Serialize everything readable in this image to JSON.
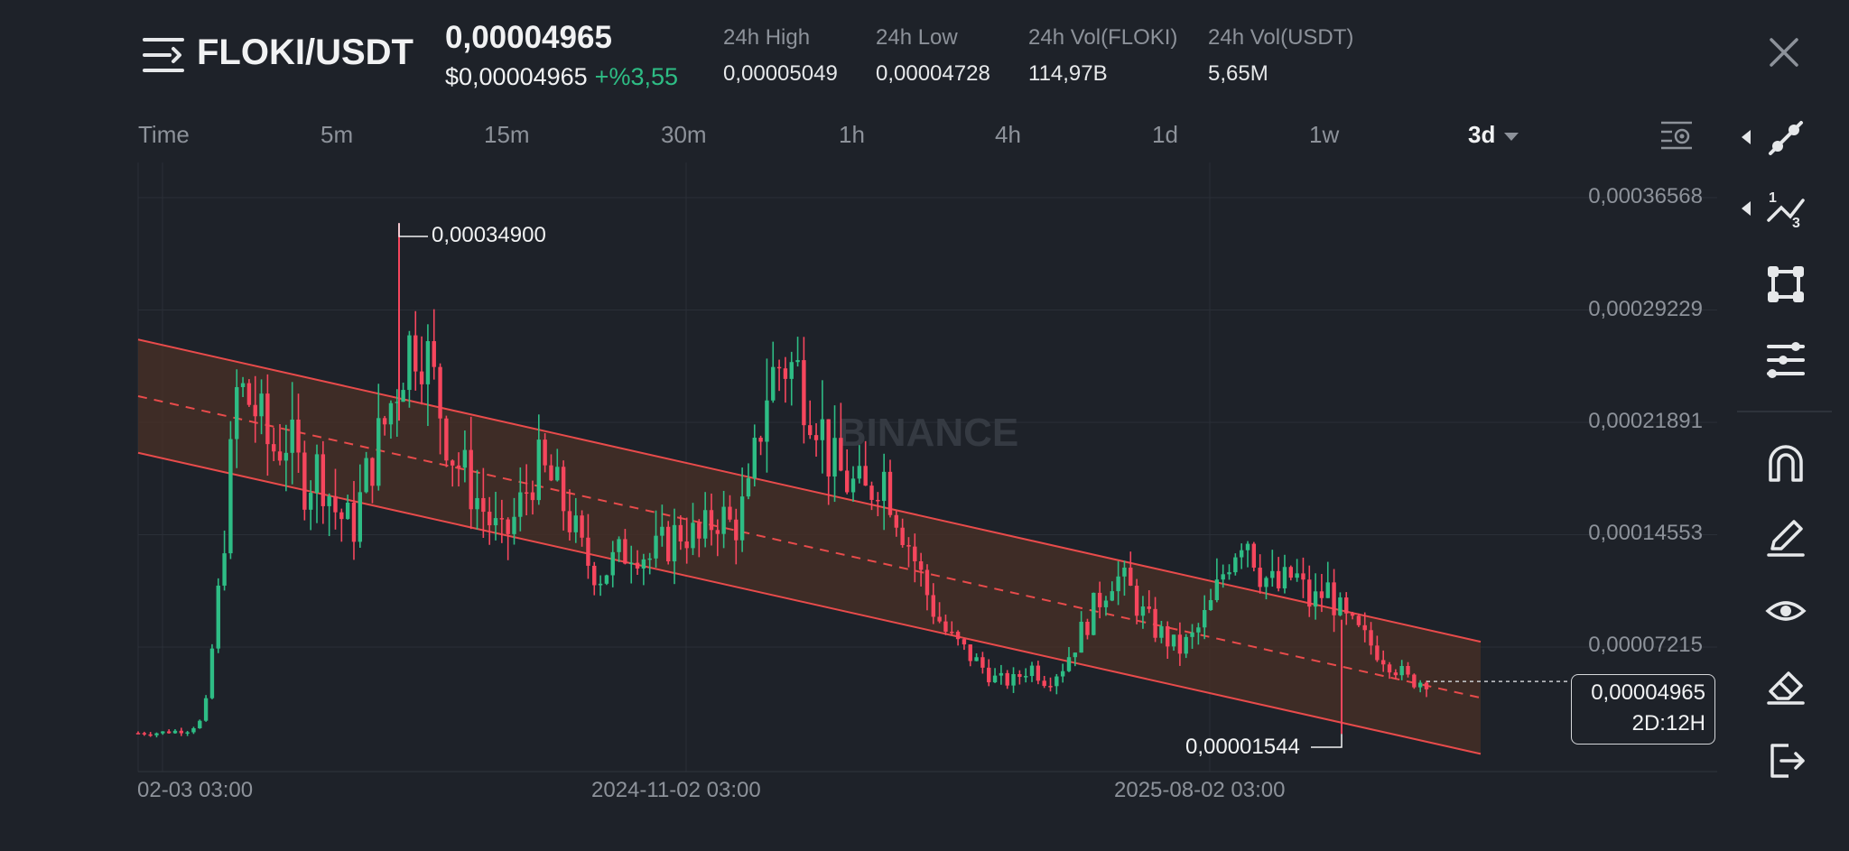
{
  "header": {
    "pair": "FLOKI/USDT",
    "last_price": "0,00004965",
    "usd_price": "$0,00004965",
    "change": "+%3,55",
    "stats": [
      {
        "label": "24h High",
        "value": "0,00005049"
      },
      {
        "label": "24h Low",
        "value": "0,00004728"
      },
      {
        "label": "24h Vol(FLOKI)",
        "value": "114,97B"
      },
      {
        "label": "24h Vol(USDT)",
        "value": "5,65M"
      }
    ]
  },
  "timeframes": {
    "items": [
      "Time",
      "5m",
      "15m",
      "30m",
      "1h",
      "4h",
      "1d",
      "1w",
      "3d"
    ],
    "active": "3d"
  },
  "chart": {
    "watermark": "BINANCE",
    "y_ticks": [
      "0,00036568",
      "0,00029229",
      "0,00021891",
      "0,00014553",
      "0,00007215"
    ],
    "x_ticks": [
      "02-03 03:00",
      "2024-11-02 03:00",
      "2025-08-02 03:00"
    ],
    "high_annotation": "0,00034900",
    "low_annotation": "0,00001544",
    "current_price": "0,00004965",
    "countdown": "2D:12H"
  },
  "chart_data": {
    "type": "candlestick",
    "title": "",
    "xlabel": "",
    "ylabel": "",
    "ylim": [
      0.0,
      0.0004
    ],
    "y_ticks": [
      0.00036568,
      0.00029229,
      0.00021891,
      0.00014553,
      7.215e-05
    ],
    "x_ticks": [
      "02-03 03:00",
      "2024-11-02 03:00",
      "2025-08-02 03:00"
    ],
    "all_time_high": 0.000349,
    "all_time_low": 1.544e-05,
    "last": 4.965e-05,
    "channel": {
      "upper": [
        [
          0,
          0.000273
        ],
        [
          1,
          7.56e-05
        ]
      ],
      "middle": [
        [
          0,
          0.000236
        ],
        [
          1,
          3.9e-05
        ]
      ],
      "lower": [
        [
          0,
          0.000199
        ],
        [
          1,
          2.4e-06
        ]
      ]
    },
    "close_series_approx": [
      1.6e-05,
      1.6e-05,
      1.7e-05,
      1.8e-05,
      2.5e-05,
      0.00012,
      0.00024,
      0.00023,
      0.0002,
      0.00021,
      0.00018,
      0.00019,
      0.00016,
      0.00015,
      0.00019,
      0.00022,
      0.00026,
      0.00028,
      0.00024,
      0.0002,
      0.00018,
      0.00016,
      0.00014,
      0.00016,
      0.00019,
      0.00018,
      0.00016,
      0.00013,
      0.00012,
      0.00013,
      0.00014,
      0.00013,
      0.00014,
      0.00015,
      0.00014,
      0.00016,
      0.00015,
      0.00017,
      0.00024,
      0.00026,
      0.00025,
      0.00023,
      0.00019,
      0.00018,
      0.00017,
      0.00019,
      0.00016,
      0.00013,
      0.0001,
      8e-05,
      7e-05,
      6e-05,
      5e-05,
      5e-05,
      6e-05,
      5e-05,
      6e-05,
      8e-05,
      0.0001,
      0.00012,
      0.00011,
      9e-05,
      8e-05,
      7e-05,
      8e-05,
      0.0001,
      0.00013,
      0.00015,
      0.00012,
      0.00011,
      0.00012,
      0.0001,
      0.00011,
      9e-05,
      8e-05,
      7e-05,
      6e-05,
      5e-05,
      5e-05
    ]
  },
  "colors": {
    "up": "#2ebd85",
    "down": "#f6465d",
    "channel": "#e84b4b",
    "channel_fill": "#4a3025",
    "background": "#1e2229"
  },
  "sidebar": {
    "icons": [
      "trend-line-icon",
      "fib-icon",
      "shape-icon",
      "indicator-icon",
      "magnet-icon",
      "pencil-icon",
      "eye-icon",
      "eraser-icon",
      "exit-icon"
    ]
  }
}
